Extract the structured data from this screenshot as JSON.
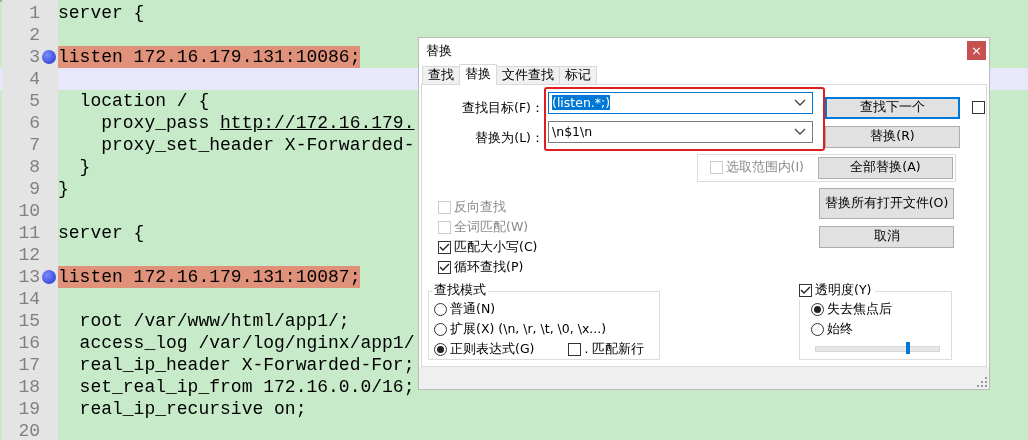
{
  "editor": {
    "lines": [
      {
        "number": "1",
        "text": "server {",
        "marked": false,
        "current": false
      },
      {
        "number": "2",
        "marked": false,
        "current": false
      },
      {
        "number": "3",
        "text": "listen 172.16.179.131:10086;",
        "marked": true,
        "current": false
      },
      {
        "number": "4",
        "marked": false,
        "current": true
      },
      {
        "number": "5",
        "text": "  location / {",
        "marked": false,
        "current": false
      },
      {
        "number": "6",
        "text": "    proxy_pass ",
        "link": "http://172.16.179.",
        "marked": false,
        "current": false
      },
      {
        "number": "7",
        "text": "    proxy_set_header X-Forwarded-",
        "marked": false,
        "current": false
      },
      {
        "number": "8",
        "text": "  }",
        "marked": false,
        "current": false
      },
      {
        "number": "9",
        "text": "}",
        "marked": false,
        "current": false
      },
      {
        "number": "10",
        "marked": false,
        "current": false
      },
      {
        "number": "11",
        "text": "server {",
        "marked": false,
        "current": false
      },
      {
        "number": "12",
        "marked": false,
        "current": false
      },
      {
        "number": "13",
        "text": "listen 172.16.179.131:10087;",
        "marked": true,
        "current": false
      },
      {
        "number": "14",
        "marked": false,
        "current": false
      },
      {
        "number": "15",
        "text": "  root /var/www/html/app1/;",
        "marked": false,
        "current": false
      },
      {
        "number": "16",
        "text": "  access_log /var/log/nginx/app1/",
        "marked": false,
        "current": false
      },
      {
        "number": "17",
        "text": "  real_ip_header X-Forwarded-For;",
        "marked": false,
        "current": false
      },
      {
        "number": "18",
        "text": "  set_real_ip_from 172.16.0.0/16;",
        "marked": false,
        "current": false
      },
      {
        "number": "19",
        "text": "  real_ip_recursive on;",
        "marked": false,
        "current": false
      },
      {
        "number": "20",
        "marked": false,
        "current": false
      }
    ]
  },
  "dialog": {
    "title": "替换",
    "close": "×",
    "tabs": [
      {
        "label": "查找",
        "selected": false
      },
      {
        "label": "替换",
        "selected": true
      },
      {
        "label": "文件查找",
        "selected": false
      },
      {
        "label": "标记",
        "selected": false
      }
    ],
    "find_label": "查找目标(F)：",
    "find_value": "(listen.*;)",
    "replace_label": "替换为(L)：",
    "replace_value": "\\n$1\\n",
    "find_next_button": "查找下一个",
    "side_checkbox": {
      "checked": false
    },
    "replace_button": "替换(R)",
    "in_selection": {
      "label": "选取范围内(I)",
      "checked": false,
      "disabled": true
    },
    "replace_all_button": "全部替换(A)",
    "replace_all_open_button": "替换所有打开文件(O)",
    "cancel_button": "取消",
    "options": [
      {
        "label": "反向查找",
        "checked": false,
        "disabled": true
      },
      {
        "label": "全词匹配(W)",
        "checked": false,
        "disabled": true
      },
      {
        "label": "匹配大小写(C)",
        "checked": true,
        "disabled": false
      },
      {
        "label": "循环查找(P)",
        "checked": true,
        "disabled": false
      }
    ],
    "search_mode": {
      "title": "查找模式",
      "options": [
        {
          "label": "普通(N)",
          "selected": false
        },
        {
          "label": "扩展(X) (\\n, \\r, \\t, \\0, \\x...)",
          "selected": false
        },
        {
          "label": "正则表达式(G)",
          "selected": true
        }
      ],
      "dot_newline": {
        "label": ". 匹配新行",
        "checked": false
      }
    },
    "transparency": {
      "label": "透明度(Y)",
      "checked": true,
      "options": [
        {
          "label": "失去焦点后",
          "selected": true
        },
        {
          "label": "始终",
          "selected": false
        }
      ],
      "level": 0.75
    }
  }
}
